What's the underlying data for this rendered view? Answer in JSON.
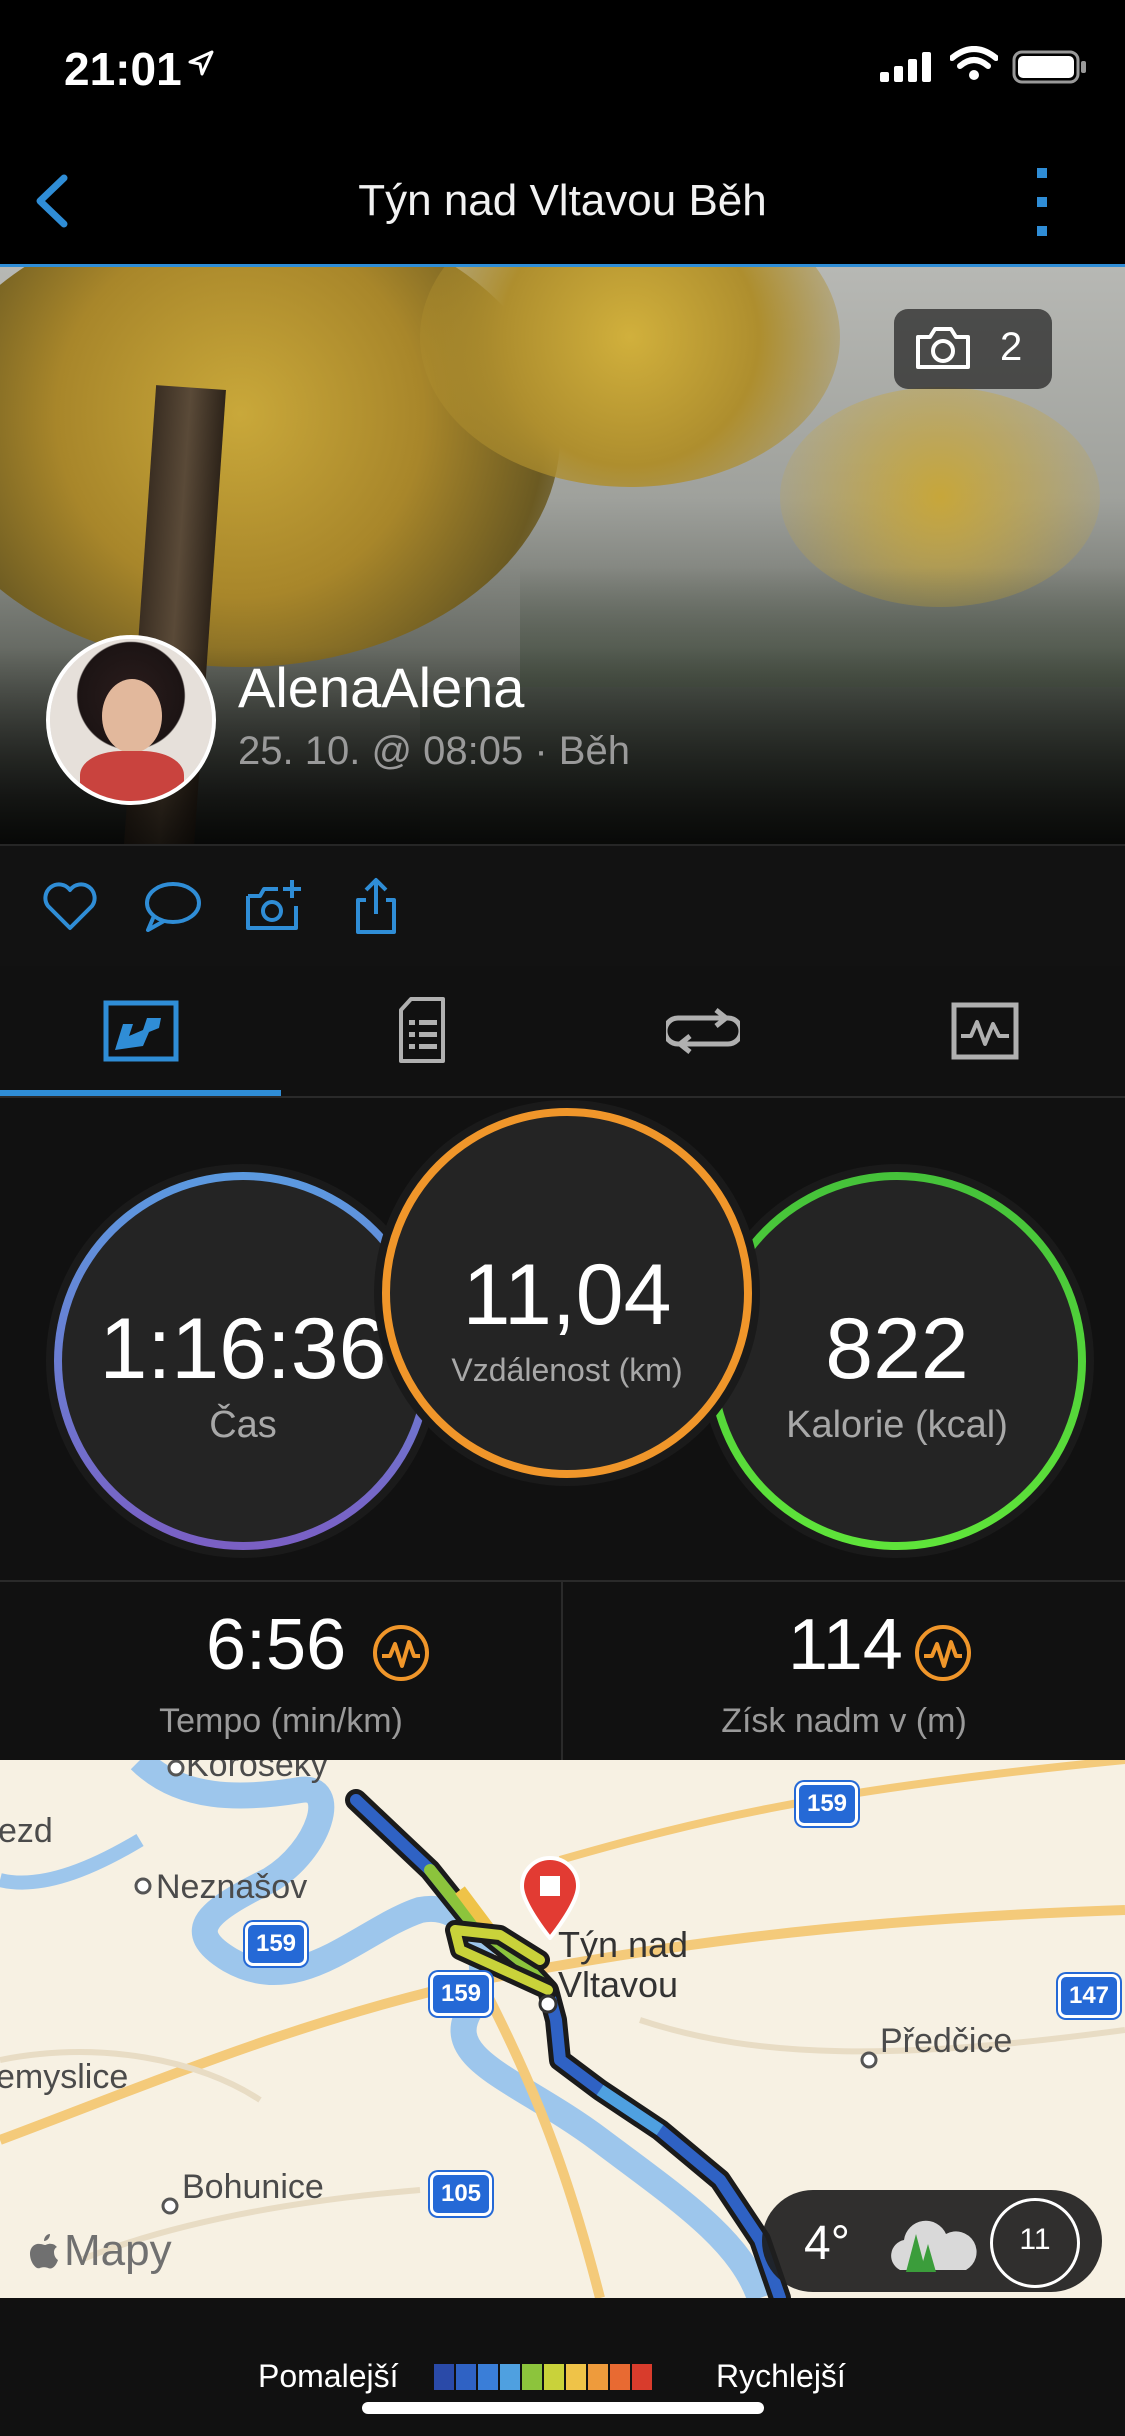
{
  "status_bar": {
    "time": "21:01"
  },
  "nav": {
    "title": "Týn nad Vltavou Běh"
  },
  "hero": {
    "photo_count": "2",
    "user_name": "AlenaAlena",
    "activity_meta": "25. 10. @ 08:05 · Běh"
  },
  "icons": {
    "back": "chevron-left-icon",
    "more": "more-vertical-icon",
    "camera": "camera-icon",
    "like": "heart-icon",
    "comment": "comment-icon",
    "add_photo": "add-photo-icon",
    "share": "share-icon",
    "tabs": [
      "summary-icon",
      "details-icon",
      "laps-icon",
      "charts-icon"
    ]
  },
  "stats": {
    "time": {
      "value": "1:16:36",
      "label": "Čas"
    },
    "distance": {
      "value": "11,04",
      "label": "Vzdálenost (km)"
    },
    "calories": {
      "value": "822",
      "label": "Kalorie (kcal)"
    },
    "pace": {
      "value": "6:56",
      "label": "Tempo (min/km)"
    },
    "elevation": {
      "value": "114",
      "label": "Získ nadm v (m)"
    }
  },
  "map": {
    "places": [
      "Neznašov",
      "Týn nad",
      "Vltavou",
      "Předčice",
      "Bohunice",
      "ezd",
      "emyslice",
      "Koroseky"
    ],
    "routes": [
      "159",
      "159",
      "159",
      "147",
      "105"
    ],
    "attribution": "Mapy",
    "weather": {
      "temp": "4°",
      "aqi": "11"
    }
  },
  "legend": {
    "slow": "Pomalejší",
    "fast": "Rychlejší",
    "colors": [
      "#2a4aa8",
      "#2f62c4",
      "#3a7ed8",
      "#4fa0e0",
      "#8cc43c",
      "#c9d23a",
      "#efc348",
      "#ee9b3c",
      "#e86a32",
      "#d83c2c"
    ]
  },
  "colors": {
    "accent": "#2f8dd6",
    "time_ring": "#5a8fd8",
    "distance_ring": "#f0962a",
    "calories_ring": "#4cd13c",
    "badge": "#f0962a"
  }
}
